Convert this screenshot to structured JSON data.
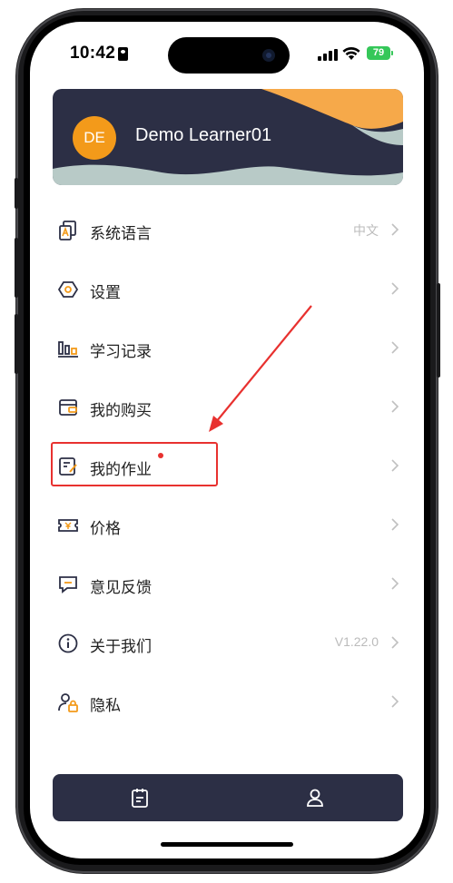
{
  "status_bar": {
    "time": "10:42",
    "battery": "79"
  },
  "profile": {
    "avatar_initials": "DE",
    "name": "Demo Learner01",
    "colors": {
      "card_bg": "#2c2f45",
      "avatar": "#f39a1a",
      "wave_orange": "#f6a94a",
      "wave_mint": "#b8cac7"
    }
  },
  "menu": {
    "items": [
      {
        "label": "系统语言",
        "value": "中文",
        "icon": "language-icon"
      },
      {
        "label": "设置",
        "value": "",
        "icon": "settings-icon"
      },
      {
        "label": "学习记录",
        "value": "",
        "icon": "learning-record-icon"
      },
      {
        "label": "我的购买",
        "value": "",
        "icon": "purchase-icon"
      },
      {
        "label": "我的作业",
        "value": "",
        "icon": "homework-icon",
        "badge": "red-dot"
      },
      {
        "label": "价格",
        "value": "",
        "icon": "price-ticket-icon"
      },
      {
        "label": "意见反馈",
        "value": "",
        "icon": "feedback-icon"
      },
      {
        "label": "关于我们",
        "value": "V1.22.0",
        "icon": "info-icon"
      },
      {
        "label": "隐私",
        "value": "",
        "icon": "privacy-user-lock-icon"
      }
    ]
  },
  "annotation": {
    "highlighted_item": "我的作业",
    "color": "#e8312f"
  },
  "tabbar": {
    "tabs": [
      {
        "icon": "clipboard-icon",
        "active": false
      },
      {
        "icon": "profile-icon",
        "active": true
      }
    ]
  }
}
